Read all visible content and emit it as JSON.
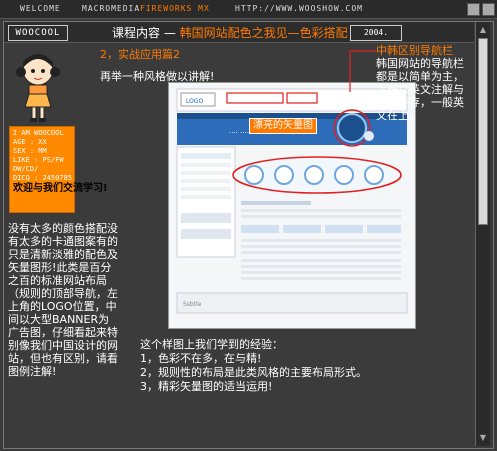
{
  "topbar": {
    "welcome": "WELCOME",
    "brand_a": "MACROMEDIA",
    "brand_b": "FIREWORKS MX",
    "url": "HTTP://WWW.WOOSHOW.COM"
  },
  "header": {
    "logo": "WOOCOOL",
    "section_label": "课程内容",
    "dash": "—",
    "section_title": "韩国网站配色之我见—色彩搭配",
    "year": "2004."
  },
  "profile": {
    "lines": [
      "I AM WOOCOOL",
      "AGE : XX",
      "SEX : MM",
      "LIKE : PS/FW",
      "DW/CD/",
      "DICQ : 2450785"
    ],
    "welcome_text": "欢迎与我们交流学习!"
  },
  "content": {
    "subtitle": "2，实战应用篇2",
    "intro": "再举一种风格做以讲解!",
    "screenshot_logo": "LOGO",
    "screenshot_tag": "漂亮的矢量图",
    "callout_title": "中韩区别导航栏",
    "callout_text": "韩国网站的导航栏都是以简单为主，上多以英文注解与韩文并存，一般英文在上。",
    "left_text": "没有太多的颜色搭配没有太多的卡通图案有的只是清新淡雅的配色及矢量图形!此类是百分之百的标准网站布局（规则的顶部导航，左上角的LOGO位置，中间以大型BANNER为广告图，仔细看起来特别像我们中国设计的网站，但也有区别，请看图例注解!",
    "experience_title": "这个样图上我们学到的经验：",
    "experience_items": [
      "1，色彩不在多，在与精!",
      "2，规则性的布局是此类风格的主要布局形式。",
      "3，精彩矢量图的适当运用!"
    ]
  },
  "colors": {
    "accent": "#ff7a00",
    "background": "#3b3b3b",
    "highlight_red": "#e02020"
  }
}
